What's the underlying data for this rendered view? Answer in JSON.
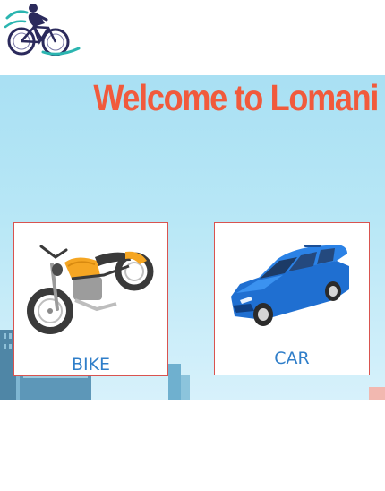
{
  "header": {
    "logo_icon": "cyclist-logo-icon"
  },
  "hero": {
    "title": "Welcome to Lomani",
    "title_color": "#f15a3c"
  },
  "vehicles": [
    {
      "label": "BIKE",
      "icon": "motorcycle-icon"
    },
    {
      "label": "CAR",
      "icon": "car-icon"
    }
  ],
  "colors": {
    "label": "#2f7ec9",
    "card_border": "#d9534f",
    "sky": "#b8e7f6"
  }
}
